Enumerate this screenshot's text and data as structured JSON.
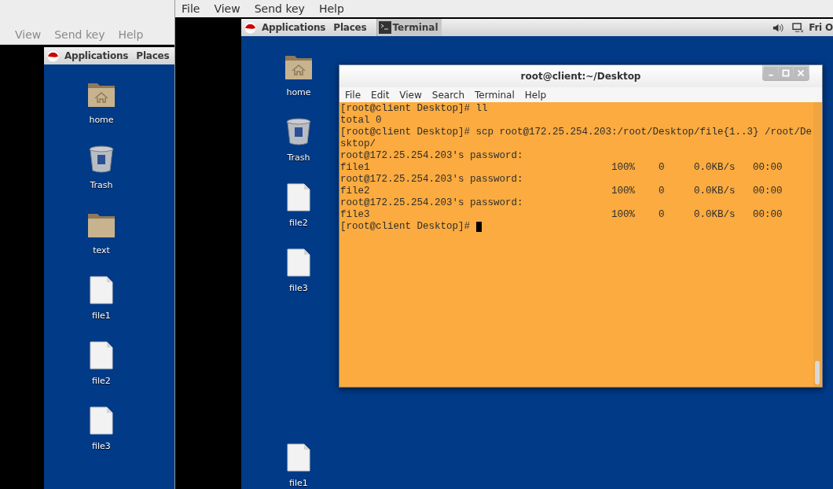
{
  "left_vm_window": {
    "menu": [
      "View",
      "Send key",
      "Help"
    ],
    "guest_panel": {
      "menus": [
        "Applications",
        "Places"
      ]
    },
    "desktop_icons": [
      {
        "kind": "home-folder",
        "label": "home"
      },
      {
        "kind": "trash",
        "label": "Trash"
      },
      {
        "kind": "folder",
        "label": "text"
      },
      {
        "kind": "file",
        "label": "file1"
      },
      {
        "kind": "file",
        "label": "file2"
      },
      {
        "kind": "file",
        "label": "file3"
      }
    ]
  },
  "right_vm_window": {
    "menu": [
      "File",
      "View",
      "Send key",
      "Help"
    ],
    "guest_panel": {
      "menus": [
        "Applications",
        "Places"
      ],
      "task": "Terminal",
      "clock": "Fri O"
    },
    "desktop_icons": [
      {
        "kind": "home-folder",
        "label": "home"
      },
      {
        "kind": "trash",
        "label": "Trash"
      },
      {
        "kind": "file",
        "label": "file2"
      },
      {
        "kind": "file",
        "label": "file3"
      },
      {
        "kind": "file",
        "label": "file1"
      }
    ],
    "terminal": {
      "title": "root@client:~/Desktop",
      "menu": [
        "File",
        "Edit",
        "View",
        "Search",
        "Terminal",
        "Help"
      ],
      "lines": [
        "[root@client Desktop]# ll",
        "total 0",
        "[root@client Desktop]# scp root@172.25.254.203:/root/Desktop/file{1..3} /root/De",
        "sktop/",
        "root@172.25.254.203's password:",
        "file1                                         100%    0     0.0KB/s   00:00",
        "root@172.25.254.203's password:",
        "file2                                         100%    0     0.0KB/s   00:00",
        "root@172.25.254.203's password:",
        "file3                                         100%    0     0.0KB/s   00:00",
        "[root@client Desktop]#"
      ],
      "cursor": true
    }
  }
}
